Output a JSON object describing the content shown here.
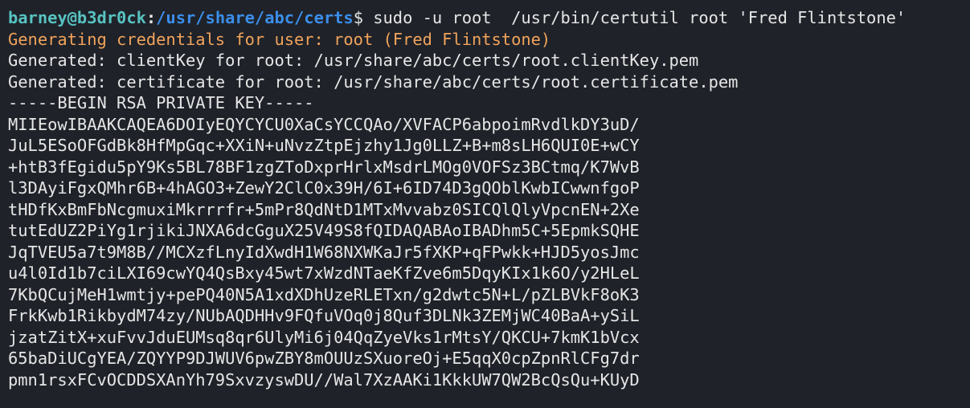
{
  "prompt": {
    "user_host": "barney@b3dr0ck",
    "colon": ":",
    "cwd": "/usr/share/abc/certs",
    "symbol": "$",
    "command": " sudo -u root  /usr/bin/certutil root 'Fred Flintstone'"
  },
  "output": {
    "generating": "Generating credentials for user: root (Fred Flintstone)",
    "generated_key": "Generated: clientKey for root: /usr/share/abc/certs/root.clientKey.pem",
    "generated_cert": "Generated: certificate for root: /usr/share/abc/certs/root.certificate.pem",
    "begin_marker": "-----BEGIN RSA PRIVATE KEY-----",
    "key_lines": [
      "MIIEowIBAAKCAQEA6DOIyEQYCYCU0XaCsYCCQAo/XVFACP6abpoimRvdlkDY3uD/",
      "JuL5ESoOFGdBk8HfMpGqc+XXiN+uNvzZtpEjzhy1Jg0LLZ+B+m8sLH6QUI0E+wCY",
      "+htB3fEgidu5pY9Ks5BL78BF1zgZToDxprHrlxMsdrLMOg0VOFSz3BCtmq/K7WvB",
      "l3DAyiFgxQMhr6B+4hAGO3+ZewY2ClC0x39H/6I+6ID74D3gQOblKwbICwwnfgoP",
      "tHDfKxBmFbNcgmuxiMkrrrfr+5mPr8QdNtD1MTxMvvabz0SICQlQlyVpcnEN+2Xe",
      "tutEdUZ2PiYg1rjikiJNXA6dcGguX25V49S8fQIDAQABAoIBADhm5C+5EpmkSQHE",
      "JqTVEU5a7t9M8B//MCXzfLnyIdXwdH1W68NXWKaJr5fXKP+qFPwkk+HJD5yosJmc",
      "u4l0Id1b7ciLXI69cwYQ4QsBxy45wt7xWzdNTaeKfZve6m5DqyKIx1k6O/y2HLeL",
      "7KbQCujMeH1wmtjy+pePQ40N5A1xdXDhUzeRLETxn/g2dwtc5N+L/pZLBVkF8oK3",
      "FrkKwb1RikbydM74zy/NUbAQDHHv9FQfuVOq0j8Quf3DLNk3ZEMjWC40BaA+ySiL",
      "jzatZitX+xuFvvJduEUMsq8qr6UlyMi6j04QqZyeVks1rMtsY/QKCU+7kmK1bVcx",
      "65baDiUCgYEA/ZQYYP9DJWUV6pwZBY8mOUUzSXuoreOj+E5qqX0cpZpnRlCFg7dr",
      "pmn1rsxFCvOCDDSXAnYh79SxvzyswDU//Wal7XzAAKi1KkkUW7QW2BcQsQu+KUyD"
    ]
  }
}
